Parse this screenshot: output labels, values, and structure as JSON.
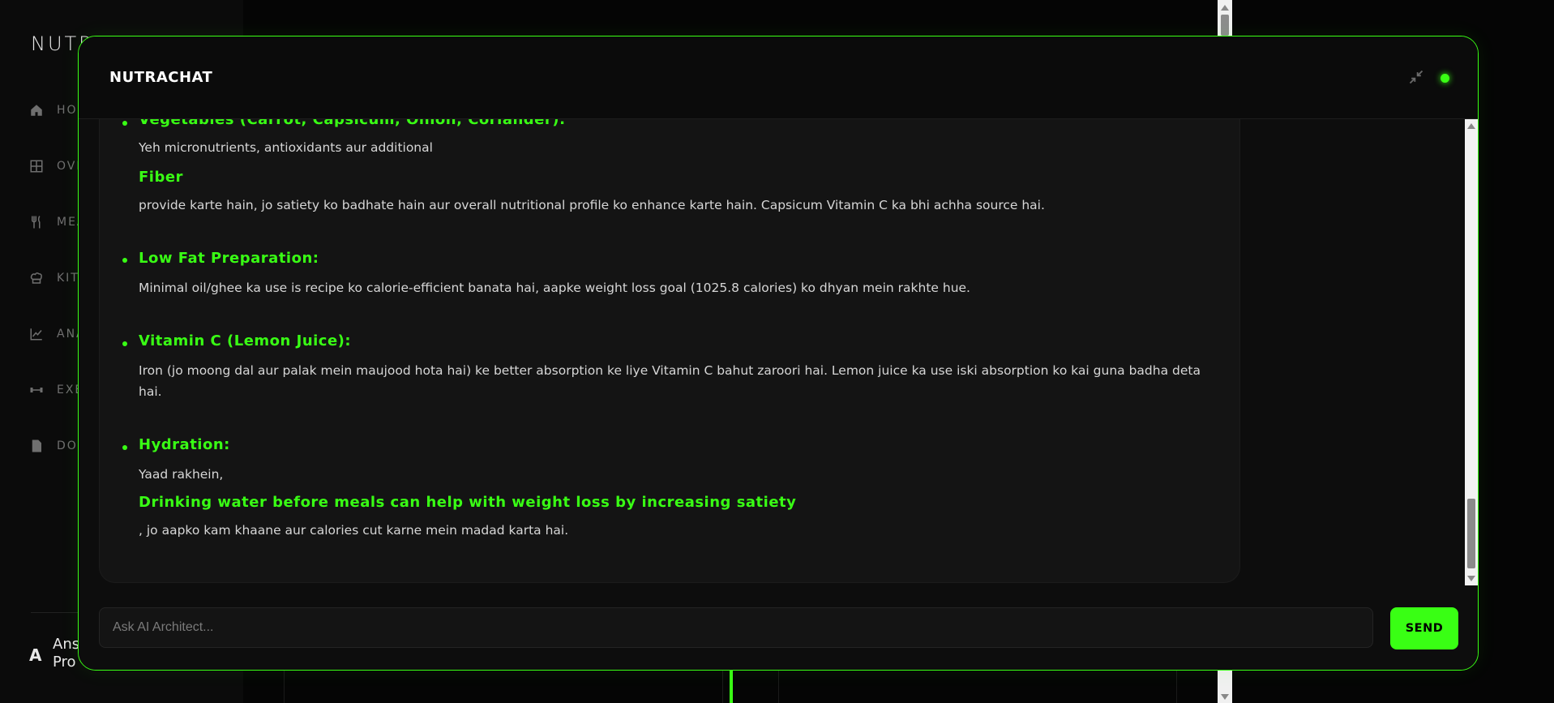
{
  "background_app": {
    "brand": "NUTR",
    "nav_items": [
      {
        "label": "HO",
        "icon": "home-icon"
      },
      {
        "label": "OVE",
        "icon": "grid-icon"
      },
      {
        "label": "MEA",
        "icon": "utensils-icon"
      },
      {
        "label": "KIT",
        "icon": "chef-hat-icon"
      },
      {
        "label": "ANA",
        "icon": "chart-line-icon"
      },
      {
        "label": "EXE",
        "icon": "dumbbell-icon"
      },
      {
        "label": "DOW",
        "icon": "document-icon"
      }
    ],
    "user_initial": "A",
    "user_name_line1": "Ans",
    "user_name_line2": "Pro"
  },
  "chat": {
    "title": "NUTRACHAT",
    "minimize_icon": "minimize-icon",
    "status_color": "#39ff14",
    "messages": {
      "cut_heading": "Vegetables (Carrot, Capsicum, Onion, Coriander):",
      "veg_line1": "Yeh micronutrients, antioxidants aur additional",
      "veg_highlight": "Fiber",
      "veg_line2": "provide karte hain, jo satiety ko badhate hain aur overall nutritional profile ko enhance karte hain. Capsicum Vitamin C ka bhi achha source hai.",
      "low_fat_heading": "Low Fat Preparation:",
      "low_fat_text": "Minimal oil/ghee ka use is recipe ko calorie-efficient banata hai, aapke weight loss goal (1025.8 calories) ko dhyan mein rakhte hue.",
      "vitc_heading": "Vitamin C (Lemon Juice):",
      "vitc_text": "Iron (jo moong dal aur palak mein maujood hota hai) ke better absorption ke liye Vitamin C bahut zaroori hai. Lemon juice ka use iski absorption ko kai guna badha deta hai.",
      "hydration_heading": "Hydration:",
      "hydration_line1": "Yaad rakhein,",
      "hydration_highlight": "Drinking water before meals can help with weight loss by increasing satiety",
      "hydration_line2": ", jo aapko kam khaane aur calories cut karne mein madad karta hai."
    },
    "input_placeholder": "Ask AI Architect...",
    "input_value": "",
    "send_label": "SEND"
  },
  "colors": {
    "accent": "#39ff14",
    "background": "#050505",
    "panel": "#0d0d0d"
  }
}
